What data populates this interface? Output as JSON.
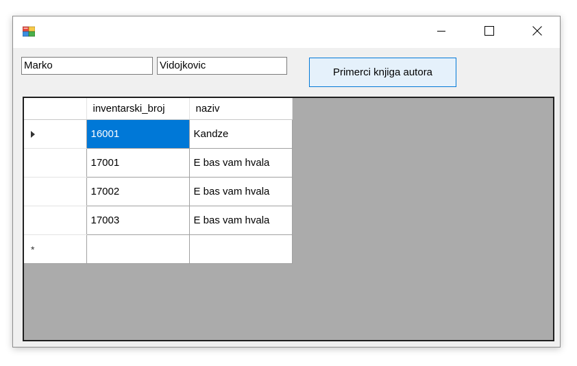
{
  "window": {
    "title": "",
    "controls": {
      "minimize": "minimize",
      "maximize": "maximize",
      "close": "close"
    }
  },
  "form": {
    "first_name_value": "Marko",
    "last_name_value": "Vidojkovic",
    "action_button_label": "Primerci knjiga autora"
  },
  "grid": {
    "columns": [
      "inventarski_broj",
      "naziv"
    ],
    "rows": [
      {
        "inventarski_broj": "16001",
        "naziv": "Kandze",
        "current": true,
        "selected_cell": "inventarski_broj"
      },
      {
        "inventarski_broj": "17001",
        "naziv": "E bas vam hvala"
      },
      {
        "inventarski_broj": "17002",
        "naziv": "E bas vam hvala"
      },
      {
        "inventarski_broj": "17003",
        "naziv": "E bas vam hvala"
      }
    ],
    "new_row_glyph": "*",
    "colors": {
      "selection": "#0078d7",
      "background": "#ababab"
    }
  }
}
